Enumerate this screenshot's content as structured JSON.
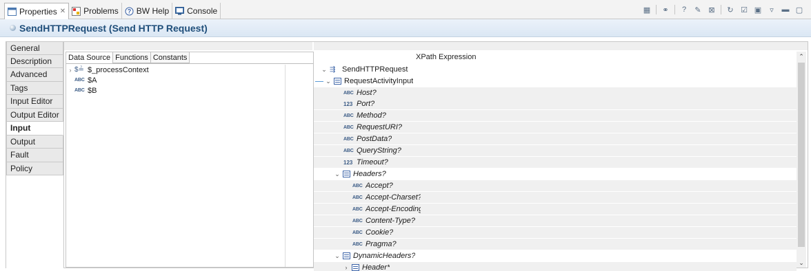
{
  "tabs": [
    {
      "label": "Properties",
      "icon": "properties-icon",
      "active": true,
      "closable": true
    },
    {
      "label": "Problems",
      "icon": "problems-icon"
    },
    {
      "label": "BW Help",
      "icon": "help-icon"
    },
    {
      "label": "Console",
      "icon": "console-icon"
    }
  ],
  "title": "SendHTTPRequest (Send HTTP Request)",
  "nav": [
    {
      "label": "General"
    },
    {
      "label": "Description"
    },
    {
      "label": "Advanced"
    },
    {
      "label": "Tags"
    },
    {
      "label": "Input Editor"
    },
    {
      "label": "Output Editor"
    },
    {
      "label": "Input",
      "selected": true
    },
    {
      "label": "Output"
    },
    {
      "label": "Fault"
    },
    {
      "label": "Policy"
    }
  ],
  "source_tabs": [
    "Data Source",
    "Functions",
    "Constants"
  ],
  "source_items": [
    {
      "label": "$_processContext",
      "type": "$",
      "expandable": true
    },
    {
      "label": "$A",
      "type": "ABC"
    },
    {
      "label": "$B",
      "type": "ABC"
    }
  ],
  "xpath_header": "XPath Expression",
  "tree": [
    {
      "label": "SendHTTPRequest-input",
      "type": "rec",
      "level": 0,
      "expanded": true,
      "clip": true
    },
    {
      "label": "RequestActivityInput",
      "type": "seq",
      "level": 0,
      "expanded": true,
      "connected": true
    },
    {
      "label": "Host?",
      "type": "ABC",
      "level": 2
    },
    {
      "label": "Port?",
      "type": "123",
      "level": 2
    },
    {
      "label": "Method?",
      "type": "ABC",
      "level": 2
    },
    {
      "label": "RequestURI?",
      "type": "ABC",
      "level": 2
    },
    {
      "label": "PostData?",
      "type": "ABC",
      "level": 2
    },
    {
      "label": "QueryString?",
      "type": "ABC",
      "level": 2
    },
    {
      "label": "Timeout?",
      "type": "123",
      "level": 2
    },
    {
      "label": "Headers?",
      "type": "seq",
      "level": 1,
      "expanded": true
    },
    {
      "label": "Accept?",
      "type": "ABC",
      "level": 3
    },
    {
      "label": "Accept-Charset?",
      "type": "ABC",
      "level": 3,
      "clip": true
    },
    {
      "label": "Accept-Encoding?",
      "type": "ABC",
      "level": 3,
      "clip": true
    },
    {
      "label": "Content-Type?",
      "type": "ABC",
      "level": 3
    },
    {
      "label": "Cookie?",
      "type": "ABC",
      "level": 3
    },
    {
      "label": "Pragma?",
      "type": "ABC",
      "level": 3
    },
    {
      "label": "DynamicHeaders?",
      "type": "seq",
      "level": 1,
      "expanded": true
    },
    {
      "label": "Header*",
      "type": "seq",
      "level": 2,
      "expanded": false
    }
  ]
}
